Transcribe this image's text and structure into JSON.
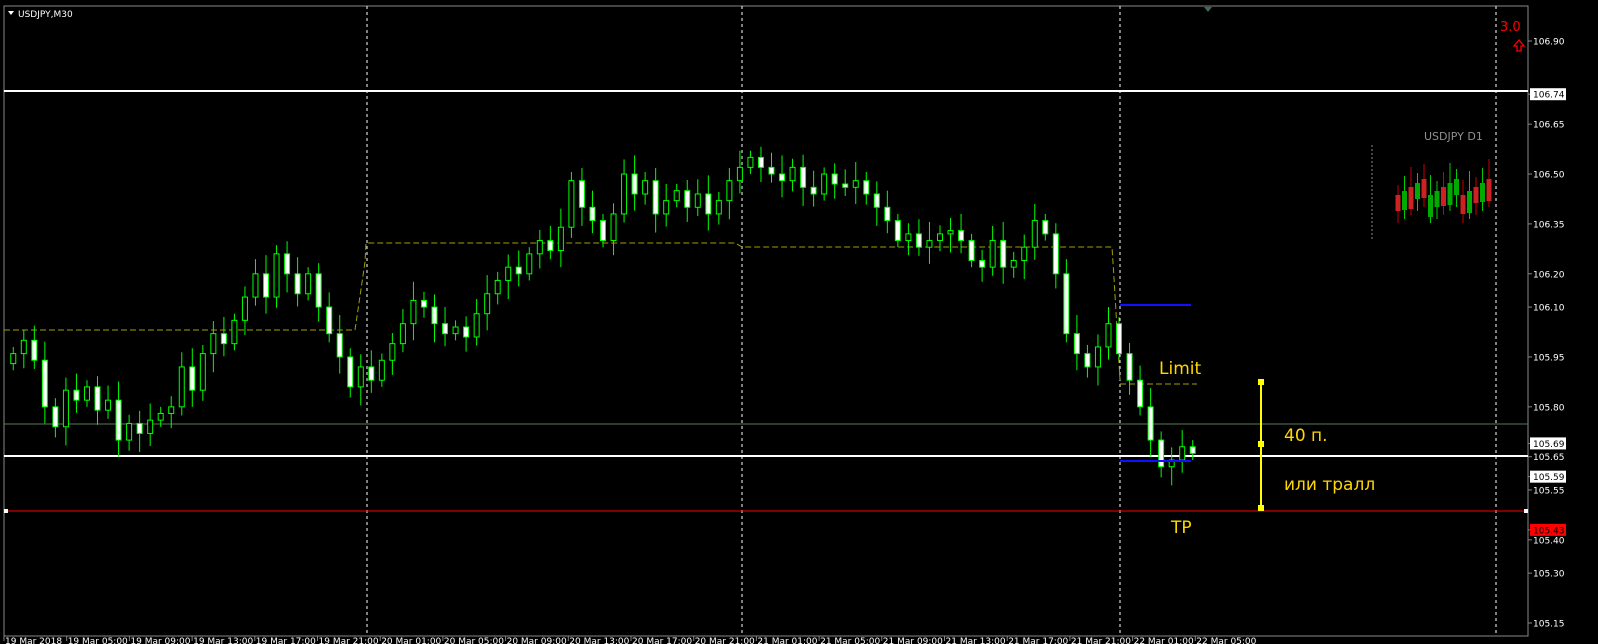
{
  "window": {
    "symbol_label": "USDJPY,M30"
  },
  "price_axis": {
    "ticks": [
      "106.90",
      "106.74",
      "106.65",
      "106.50",
      "106.35",
      "106.20",
      "106.10",
      "105.95",
      "105.80",
      "105.69",
      "105.65",
      "105.59",
      "105.55",
      "105.43",
      "105.40",
      "105.30",
      "105.15"
    ],
    "highlight_white": [
      "106.74",
      "105.69",
      "105.59"
    ],
    "highlight_red": "105.43"
  },
  "time_axis": {
    "labels": [
      "19 Mar 2018",
      "19 Mar 05:00",
      "19 Mar 09:00",
      "19 Mar 13:00",
      "19 Mar 17:00",
      "19 Mar 21:00",
      "20 Mar 01:00",
      "20 Mar 05:00",
      "20 Mar 09:00",
      "20 Mar 13:00",
      "20 Mar 17:00",
      "20 Mar 21:00",
      "21 Mar 01:00",
      "21 Mar 05:00",
      "21 Mar 09:00",
      "21 Mar 13:00",
      "21 Mar 17:00",
      "21 Mar 21:00",
      "22 Mar 01:00",
      "22 Mar 05:00"
    ]
  },
  "annotations": {
    "limit": "Limit",
    "points": "40 п.",
    "trail": "или тралл",
    "tp": "TP",
    "mini_chart_title": "USDJPY D1",
    "corner_value": "3.0"
  },
  "colors": {
    "bull": "#00ff00",
    "bear_body": "#ffffff",
    "level_white": "#ffffff",
    "level_red": "#ff0000",
    "pivot": "#a0a000",
    "box": "#0000ff",
    "measure": "#ffff00",
    "annot": "#ffd700"
  },
  "chart_data": {
    "type": "candlestick",
    "symbol": "USDJPY",
    "timeframe": "M30",
    "ylim": [
      105.1,
      106.95
    ],
    "levels": {
      "upper_white": 106.74,
      "current": 105.69,
      "lower_white": 105.59,
      "take_profit_red": 105.43
    }
  }
}
